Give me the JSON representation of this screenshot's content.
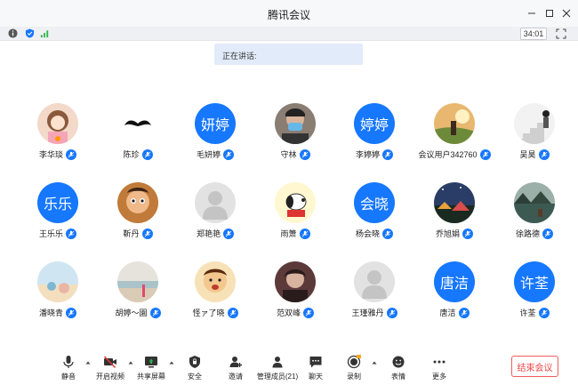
{
  "window": {
    "title": "腾讯会议"
  },
  "infobar": {
    "timer": "34:01"
  },
  "speaking": {
    "label": "正在讲话:"
  },
  "participants": [
    {
      "name": "李华琰",
      "avatar_type": "photo-girl"
    },
    {
      "name": "陈珍",
      "avatar_type": "photo-mustache"
    },
    {
      "name": "毛妍婷",
      "avatar_type": "text",
      "avatar_text": "妍婷"
    },
    {
      "name": "守林",
      "avatar_type": "photo-mask"
    },
    {
      "name": "李婷婷",
      "avatar_type": "text",
      "avatar_text": "婷婷"
    },
    {
      "name": "会议用户342760",
      "avatar_type": "photo-sunset"
    },
    {
      "name": "吴昊",
      "avatar_type": "photo-stairs"
    },
    {
      "name": "王乐乐",
      "avatar_type": "text",
      "avatar_text": "乐乐"
    },
    {
      "name": "靳丹",
      "avatar_type": "photo-cartoon"
    },
    {
      "name": "郑艳艳",
      "avatar_type": "default"
    },
    {
      "name": "雨箫",
      "avatar_type": "photo-snoopy"
    },
    {
      "name": "杨会晓",
      "avatar_type": "text",
      "avatar_text": "会晓"
    },
    {
      "name": "乔旭娟",
      "avatar_type": "photo-night"
    },
    {
      "name": "徐路德",
      "avatar_type": "photo-lake"
    },
    {
      "name": "潘晓青",
      "avatar_type": "photo-beach"
    },
    {
      "name": "胡婷～園",
      "avatar_type": "photo-shore"
    },
    {
      "name": "怪ァ了晓",
      "avatar_type": "photo-kid"
    },
    {
      "name": "范双峰",
      "avatar_type": "photo-dark"
    },
    {
      "name": "王瑾雅丹",
      "avatar_type": "default"
    },
    {
      "name": "唐洁",
      "avatar_type": "text",
      "avatar_text": "唐洁"
    },
    {
      "name": "许荃",
      "avatar_type": "text",
      "avatar_text": "许荃"
    }
  ],
  "toolbar": {
    "mute": "静音",
    "video": "开启视频",
    "share": "共享屏幕",
    "security": "安全",
    "invite": "邀请",
    "members": "管理成员(21)",
    "chat": "聊天",
    "record": "录制",
    "emoji": "表情",
    "more": "更多",
    "end": "结束会议"
  },
  "colors": {
    "accent": "#1677ff",
    "danger": "#f04545",
    "speaking_bg": "#e2ebf9"
  },
  "icons": [
    "info-icon",
    "shield-icon",
    "signal-icon",
    "fullscreen-icon",
    "mic-icon",
    "camera-off-icon",
    "share-screen-icon",
    "security-icon",
    "invite-icon",
    "members-icon",
    "chat-icon",
    "record-icon",
    "emoji-icon",
    "more-icon"
  ]
}
